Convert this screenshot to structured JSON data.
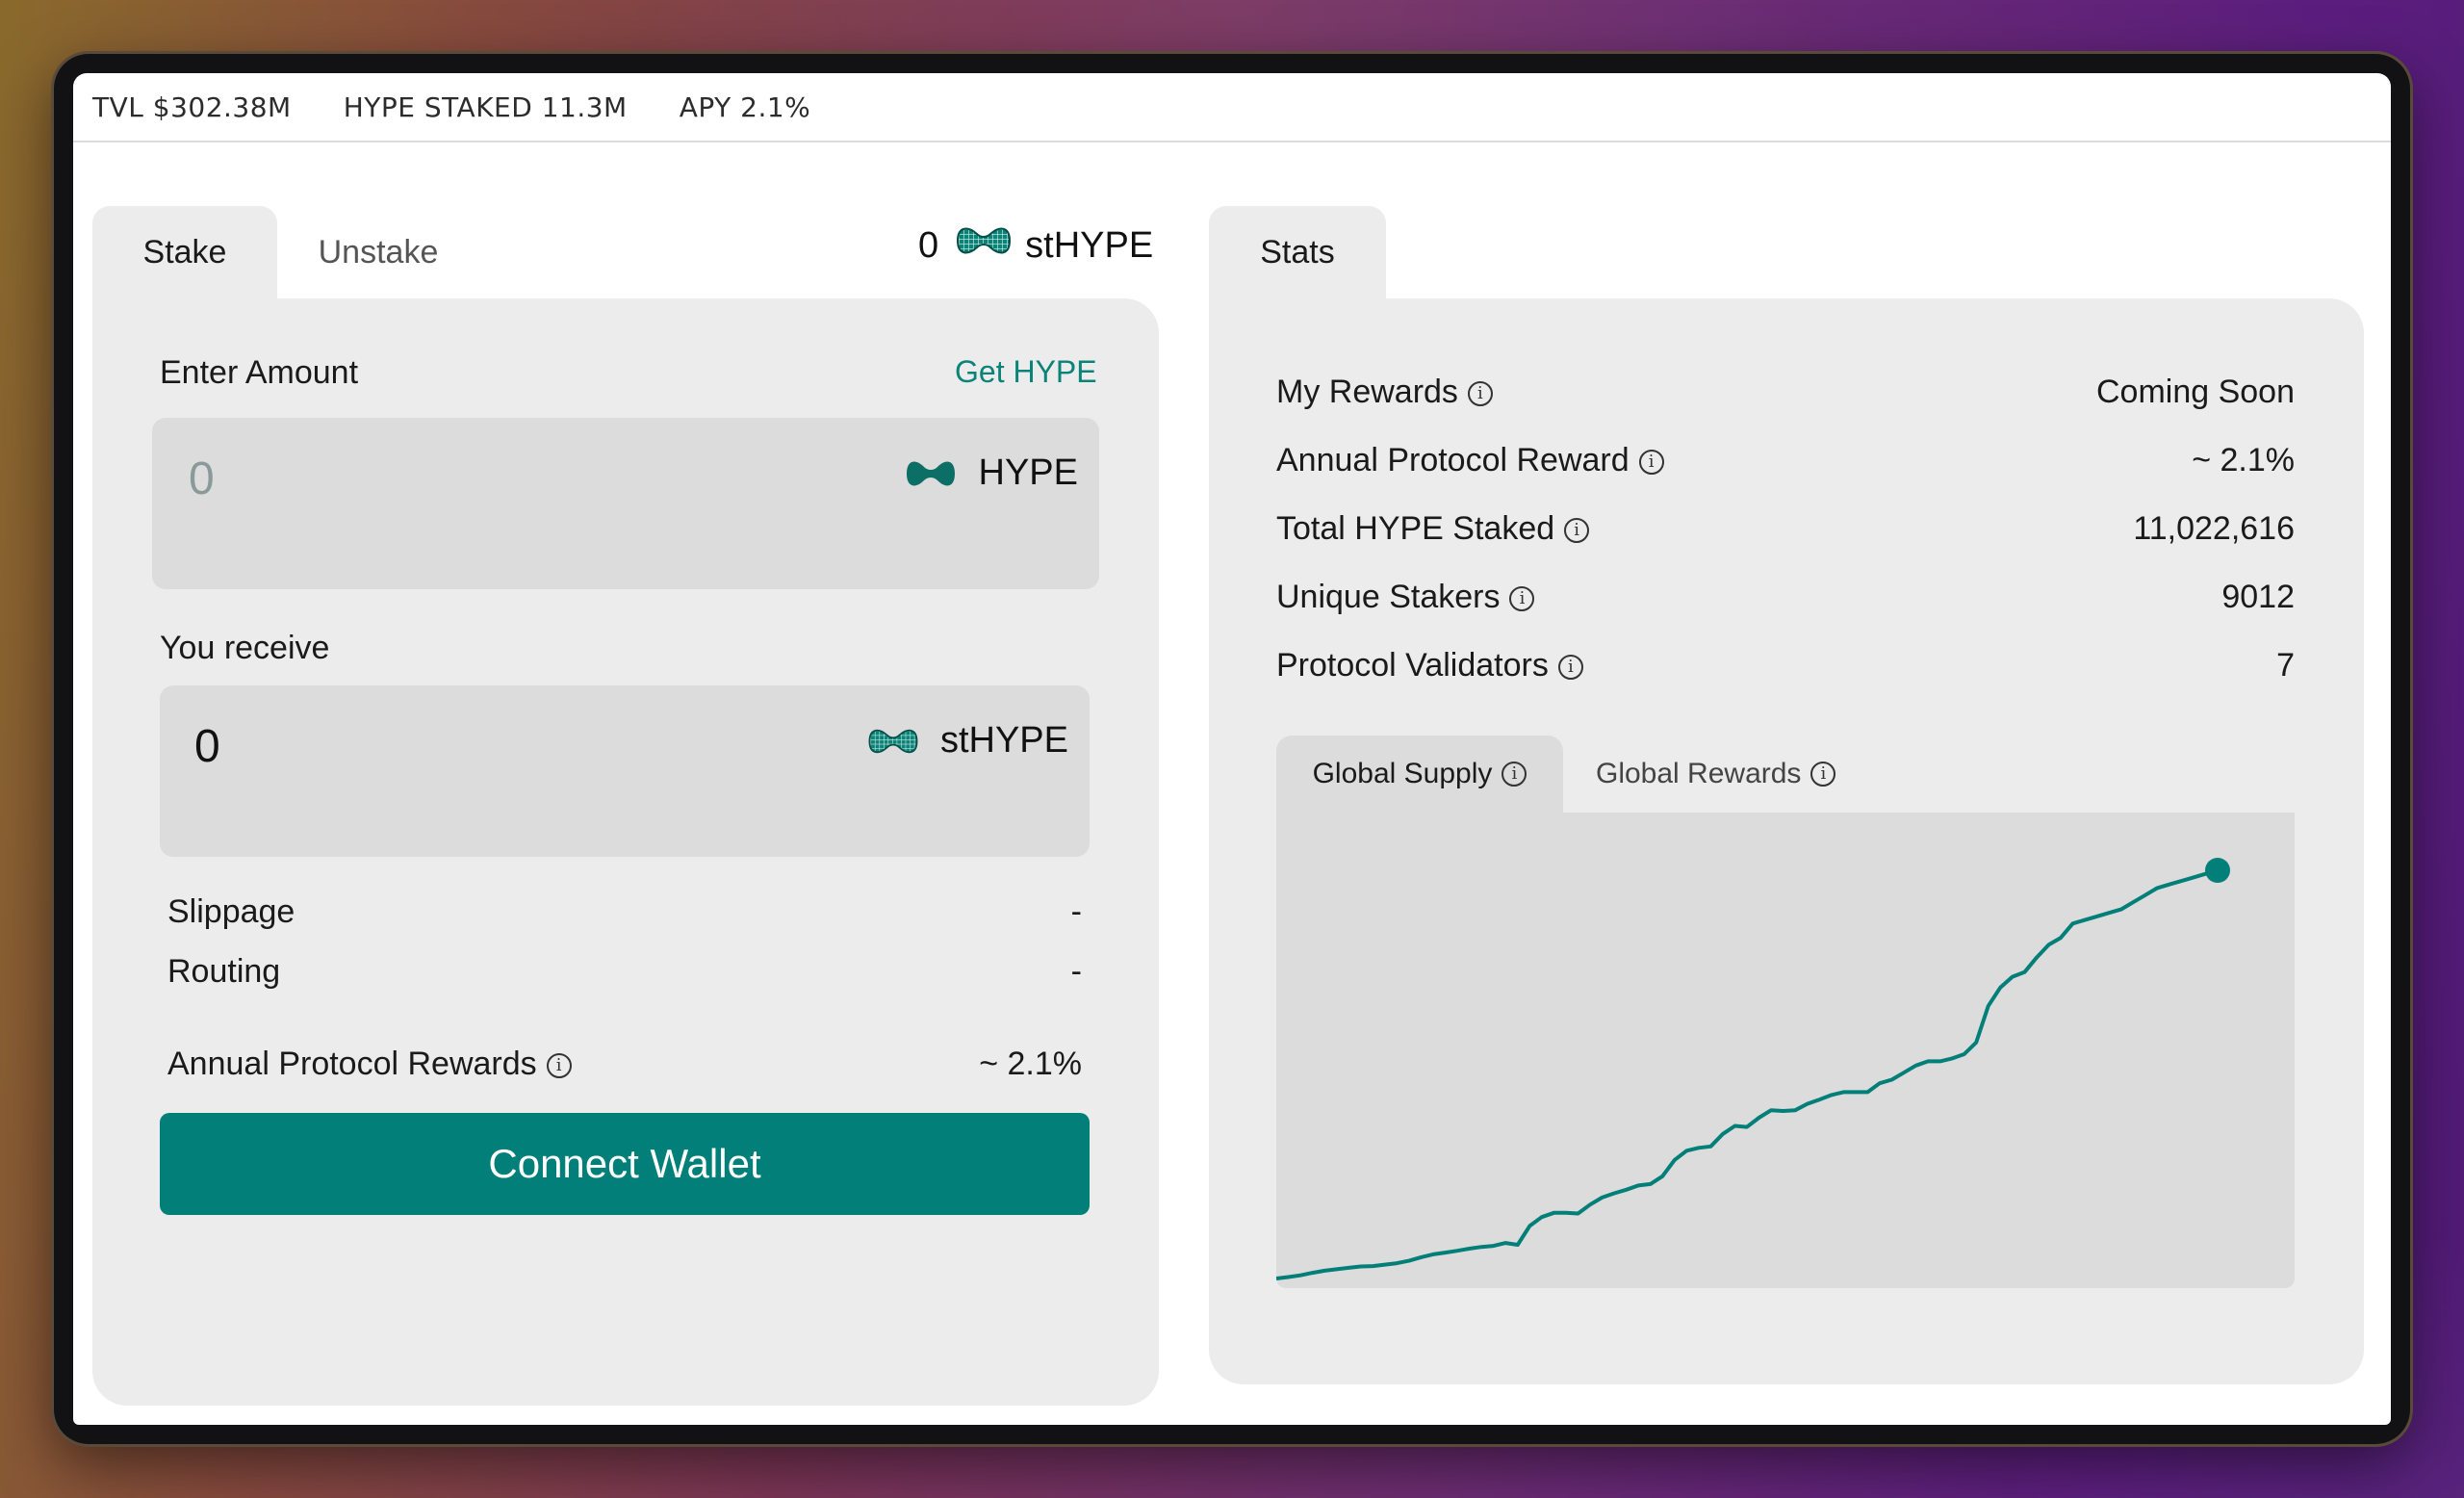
{
  "topbar": {
    "tvl": "TVL $302.38M",
    "staked": "HYPE STAKED 11.3M",
    "apy": "APY 2.1%"
  },
  "stake_panel": {
    "tabs": [
      "Stake",
      "Unstake"
    ],
    "balance_value": "0",
    "balance_token": "stHYPE",
    "enter_amount_label": "Enter Amount",
    "get_hype_link": "Get HYPE",
    "amount_placeholder": "0",
    "amount_token": "HYPE",
    "receive_label": "You receive",
    "receive_value": "0",
    "receive_token": "stHYPE",
    "slippage_label": "Slippage",
    "slippage_value": "-",
    "routing_label": "Routing",
    "routing_value": "-",
    "rewards_label": "Annual Protocol Rewards",
    "rewards_value": "~ 2.1%",
    "connect_button": "Connect Wallet"
  },
  "stats_panel": {
    "tab": "Stats",
    "rows": [
      {
        "name": "My Rewards",
        "value": "Coming Soon"
      },
      {
        "name": "Annual Protocol Reward",
        "value": "~ 2.1%"
      },
      {
        "name": "Total HYPE Staked",
        "value": "11,022,616"
      },
      {
        "name": "Unique Stakers",
        "value": "9012"
      },
      {
        "name": "Protocol Validators",
        "value": "7"
      }
    ],
    "chart_tabs": [
      "Global Supply",
      "Global Rewards"
    ]
  },
  "colors": {
    "accent": "#017f78",
    "link": "#0a8378",
    "panel": "#ececec",
    "field": "#dcdcdc"
  },
  "icons": {
    "hype": "hype-logo-icon",
    "sthype": "sthype-logo-icon",
    "info": "info-circle-icon"
  },
  "chart_data": {
    "type": "line",
    "title": "",
    "xlabel": "",
    "ylabel": "",
    "x": [
      0,
      1,
      2,
      3,
      4,
      5,
      6,
      7,
      8,
      9,
      10,
      11,
      12,
      13,
      14,
      15,
      16,
      17,
      18,
      19,
      20,
      21,
      22,
      23,
      24,
      25,
      26,
      27,
      28,
      29,
      30,
      31,
      32,
      33,
      34,
      35,
      36,
      37,
      38,
      39,
      40,
      41,
      42,
      43,
      44,
      45,
      46,
      47,
      48,
      49,
      50,
      51,
      52,
      53,
      54,
      55,
      56,
      57,
      58,
      59,
      60,
      61,
      62,
      63,
      64,
      65,
      66,
      67,
      68,
      69,
      70,
      71,
      72,
      73,
      74,
      75,
      76,
      77,
      78
    ],
    "series": [
      {
        "values": [
          0.0,
          0.4,
          0.9,
          1.6,
          2.2,
          2.6,
          3.0,
          3.4,
          3.5,
          3.9,
          4.3,
          5.0,
          6.0,
          6.8,
          7.3,
          7.8,
          8.4,
          8.9,
          9.2,
          10.0,
          9.5,
          14.8,
          17.3,
          18.5,
          18.5,
          18.3,
          20.8,
          22.8,
          24.0,
          25.0,
          26.2,
          26.6,
          28.8,
          33.4,
          36.0,
          36.8,
          37.2,
          40.7,
          43.0,
          42.7,
          45.3,
          47.4,
          47.2,
          47.4,
          49.2,
          50.4,
          51.7,
          52.5,
          52.5,
          52.5,
          55.0,
          56.0,
          58.0,
          60.0,
          61.2,
          61.2,
          62.0,
          63.2,
          66.5,
          76.8,
          82.0,
          85.0,
          86.3,
          90.4,
          94.0,
          96.0,
          100.0,
          101.0,
          102.0,
          103.0,
          104.0,
          106.0,
          108.0,
          110.0,
          111.0,
          112.0,
          113.0,
          114.0,
          115.0
        ],
        "color": "#017f78"
      }
    ],
    "grid": false,
    "legend": "none"
  }
}
